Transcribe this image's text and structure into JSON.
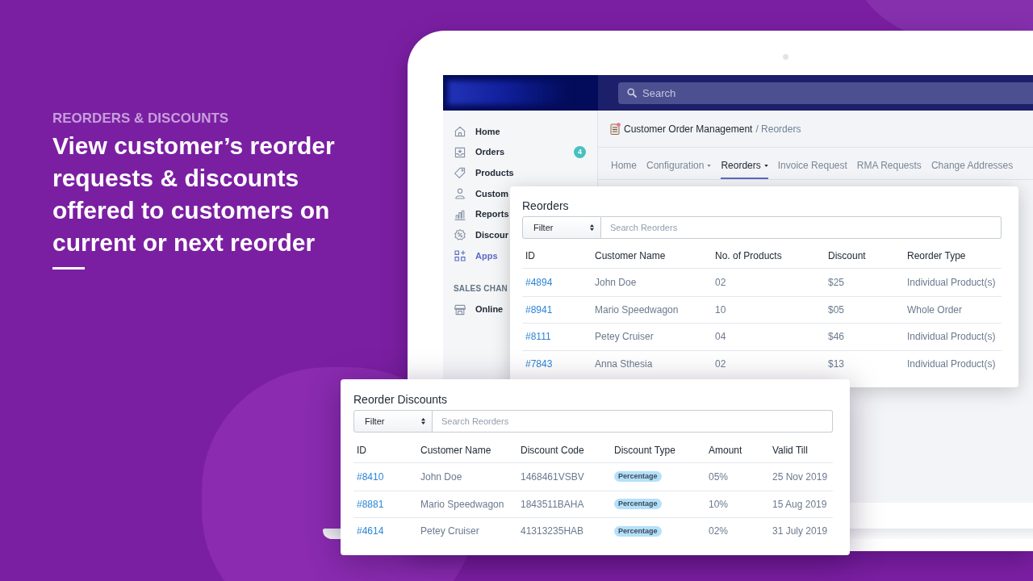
{
  "intro": {
    "eyebrow": "REORDERS & DISCOUNTS",
    "headline": "View customer’s reorder requests & discounts offered to customers on current or next reorder"
  },
  "app": {
    "search": {
      "placeholder": "Search"
    },
    "sidebar": {
      "items": [
        {
          "label": "Home",
          "selected": false
        },
        {
          "label": "Orders",
          "selected": false,
          "badge": "4"
        },
        {
          "label": "Products",
          "selected": false
        },
        {
          "label": "Custom",
          "selected": false
        },
        {
          "label": "Reports",
          "selected": false
        },
        {
          "label": "Discour",
          "selected": false
        },
        {
          "label": "Apps",
          "selected": true
        }
      ],
      "section_title": "SALES CHAN",
      "channels": [
        {
          "label": "Online",
          "selected": false
        }
      ]
    },
    "breadcrumb": {
      "path": "Customer Order Management",
      "current": "/ Reorders"
    },
    "tabs": [
      {
        "label": "Home",
        "selected": false,
        "dropdown": false
      },
      {
        "label": "Configuration",
        "selected": false,
        "dropdown": true
      },
      {
        "label": "Reorders",
        "selected": true,
        "dropdown": true
      },
      {
        "label": "Invoice Request",
        "selected": false,
        "dropdown": false
      },
      {
        "label": "RMA Requests",
        "selected": false,
        "dropdown": false
      },
      {
        "label": "Change Addresses",
        "selected": false,
        "dropdown": false
      }
    ]
  },
  "reorders_card": {
    "title": "Reorders",
    "filter": "Filter",
    "search": {
      "placeholder": "Search Reorders"
    },
    "columns": [
      {
        "label": "ID",
        "kind": "link"
      },
      {
        "label": "Customer Name",
        "kind": "text"
      },
      {
        "label": "No. of Products",
        "kind": "text"
      },
      {
        "label": "Discount",
        "kind": "text"
      },
      {
        "label": "Reorder Type",
        "kind": "text"
      }
    ],
    "rows": [
      [
        "#4894",
        "John Doe",
        "02",
        "$25",
        "Individual Product(s)"
      ],
      [
        "#8941",
        "Mario Speedwagon",
        "10",
        "$05",
        "Whole Order"
      ],
      [
        "#8111",
        "Petey Cruiser",
        "04",
        "$46",
        "Individual Product(s)"
      ],
      [
        "#7843",
        "Anna Sthesia",
        "02",
        "$13",
        "Individual Product(s)"
      ]
    ]
  },
  "discounts_card": {
    "title": "Reorder Discounts",
    "filter": "Filter",
    "search": {
      "placeholder": "Search Reorders"
    },
    "columns": [
      {
        "label": "ID",
        "kind": "link"
      },
      {
        "label": "Customer Name",
        "kind": "text"
      },
      {
        "label": "Discount Code",
        "kind": "text"
      },
      {
        "label": "Discount Type",
        "kind": "badge"
      },
      {
        "label": "Amount",
        "kind": "text"
      },
      {
        "label": "Valid Till",
        "kind": "text"
      }
    ],
    "rows": [
      [
        "#8410",
        "John Doe",
        "1468461VSBV",
        "Percentage",
        "05%",
        "25 Nov 2019"
      ],
      [
        "#8881",
        "Mario Speedwagon",
        "1843511BAHA",
        "Percentage",
        "10%",
        "15 Aug 2019"
      ],
      [
        "#4614",
        "Petey Cruiser",
        "41313235HAB",
        "Percentage",
        "02%",
        "31 July 2019"
      ]
    ]
  }
}
